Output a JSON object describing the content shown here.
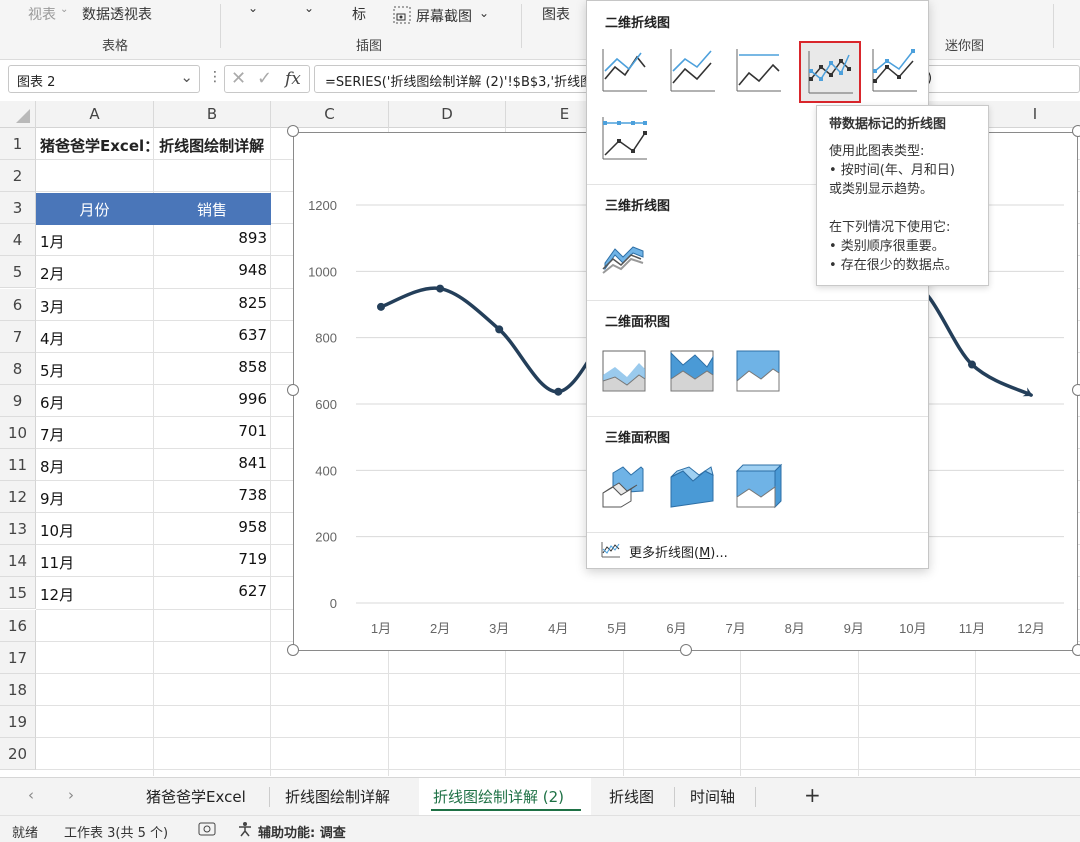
{
  "ribbon": {
    "view_label": "视表",
    "pivot_label": "数据透视表",
    "group_table": "表格",
    "group_illustrations": "插图",
    "mark_label": "标",
    "screenshot_label": "屏幕截图",
    "chart_label": "图表",
    "group_sparkline": "迷你图"
  },
  "formula_bar": {
    "name_box": "图表 2",
    "fx": "fx",
    "formula": "=SERIES('折线图绘制详解 (2)'!$B$3,'折线图绘",
    "formula_tail": ")"
  },
  "columns": [
    "A",
    "B",
    "C",
    "D",
    "E",
    "I"
  ],
  "rows": [
    "1",
    "2",
    "3",
    "4",
    "5",
    "6",
    "7",
    "8",
    "9",
    "10",
    "11",
    "12",
    "13",
    "14",
    "15",
    "16",
    "17",
    "18",
    "19",
    "20"
  ],
  "sheet": {
    "title": "猪爸爸学Excel：折线图绘制详解",
    "header_month": "月份",
    "header_sales": "销售",
    "months": [
      "1月",
      "2月",
      "3月",
      "4月",
      "5月",
      "6月",
      "7月",
      "8月",
      "9月",
      "10月",
      "11月",
      "12月"
    ],
    "sales": [
      "893",
      "948",
      "825",
      "637",
      "858",
      "996",
      "701",
      "841",
      "738",
      "958",
      "719",
      "627"
    ]
  },
  "chart_data": {
    "type": "line",
    "categories": [
      "1月",
      "2月",
      "3月",
      "4月",
      "5月",
      "6月",
      "7月",
      "8月",
      "9月",
      "10月",
      "11月",
      "12月"
    ],
    "series": [
      {
        "values": [
          893,
          948,
          825,
          637,
          858,
          996,
          701,
          841,
          738,
          958,
          719,
          627
        ]
      }
    ],
    "ylim": [
      0,
      1200
    ],
    "yticks": [
      "0",
      "200",
      "400",
      "600",
      "800",
      "1000",
      "1200"
    ],
    "smooth": true,
    "markers": true,
    "end_arrow": true,
    "grid": true,
    "line_color": "#243f5a"
  },
  "dropdown": {
    "section_2d_line": "二维折线图",
    "section_3d_line": "三维折线图",
    "section_2d_area": "二维面积图",
    "section_3d_area": "三维面积图",
    "more_label": "更多折线图(",
    "more_key": "M",
    "more_suffix": ")...",
    "selected_icon": "line-with-markers-icon",
    "highlight_color": "#d9262c"
  },
  "tooltip": {
    "title": "带数据标记的折线图",
    "line1": "使用此图表类型:",
    "line2": "• 按时间(年、月和日)",
    "line3": "或类别显示趋势。",
    "line4": "在下列情况下使用它:",
    "line5": "• 类别顺序很重要。",
    "line6": "• 存在很少的数据点。"
  },
  "tabs": {
    "items": [
      "猪爸爸学Excel",
      "折线图绘制详解",
      "折线图绘制详解 (2)",
      "折线图",
      "时间轴"
    ],
    "active_index": 2,
    "add": "+"
  },
  "status": {
    "ready": "就绪",
    "sheet_info": "工作表 3(共 5 个)",
    "accessibility": "辅助功能: 调查"
  },
  "colors": {
    "header_fill": "#4a76b9",
    "active_tab_underline": "#1e7145"
  }
}
